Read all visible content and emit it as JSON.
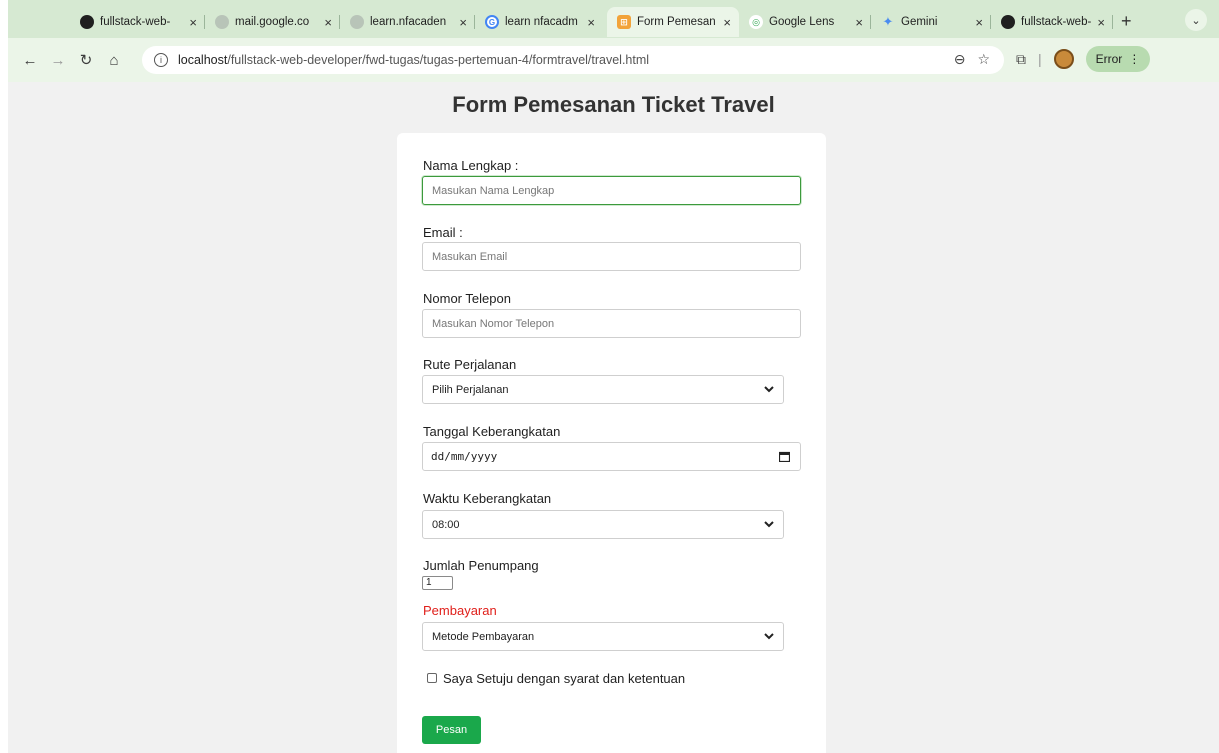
{
  "browser": {
    "tabs": [
      {
        "title": "fullstack-web-",
        "favicon": "github-icon",
        "active": false
      },
      {
        "title": "mail.google.co",
        "favicon": "globe-icon",
        "active": false
      },
      {
        "title": "learn.nfacaden",
        "favicon": "globe-icon",
        "active": false
      },
      {
        "title": "learn nfacadm",
        "favicon": "google-icon",
        "active": false
      },
      {
        "title": "Form Pemesan",
        "favicon": "form-icon",
        "active": true
      },
      {
        "title": "Google Lens",
        "favicon": "lens-icon",
        "active": false
      },
      {
        "title": "Gemini",
        "favicon": "gemini-icon",
        "active": false
      },
      {
        "title": "fullstack-web-",
        "favicon": "github-icon",
        "active": false
      }
    ],
    "url_host": "localhost",
    "url_path": "/fullstack-web-developer/fwd-tugas/tugas-pertemuan-4/formtravel/travel.html",
    "error_label": "Error",
    "accent": "#d6e9d2"
  },
  "form": {
    "title": "Form Pemesanan Ticket Travel",
    "nama_label": "Nama Lengkap :",
    "nama_placeholder": "Masukan Nama Lengkap",
    "email_label": "Email :",
    "email_placeholder": "Masukan Email",
    "telepon_label": "Nomor Telepon",
    "telepon_placeholder": "Masukan Nomor Telepon",
    "rute_label": "Rute Perjalanan",
    "rute_value": "Pilih Perjalanan",
    "tanggal_label": "Tanggal Keberangkatan",
    "tanggal_value": "dd/mm/yyyy",
    "waktu_label": "Waktu Keberangkatan",
    "waktu_value": "08:00",
    "jumlah_label": "Jumlah Penumpang",
    "jumlah_value": "1",
    "pembayaran_label": "Pembayaran",
    "pembayaran_value": "Metode Pembayaran",
    "setuju_label": "Saya Setuju dengan syarat dan ketentuan",
    "submit_label": "Pesan",
    "label_red": "#e0201b",
    "button_color": "#1aa84b"
  }
}
